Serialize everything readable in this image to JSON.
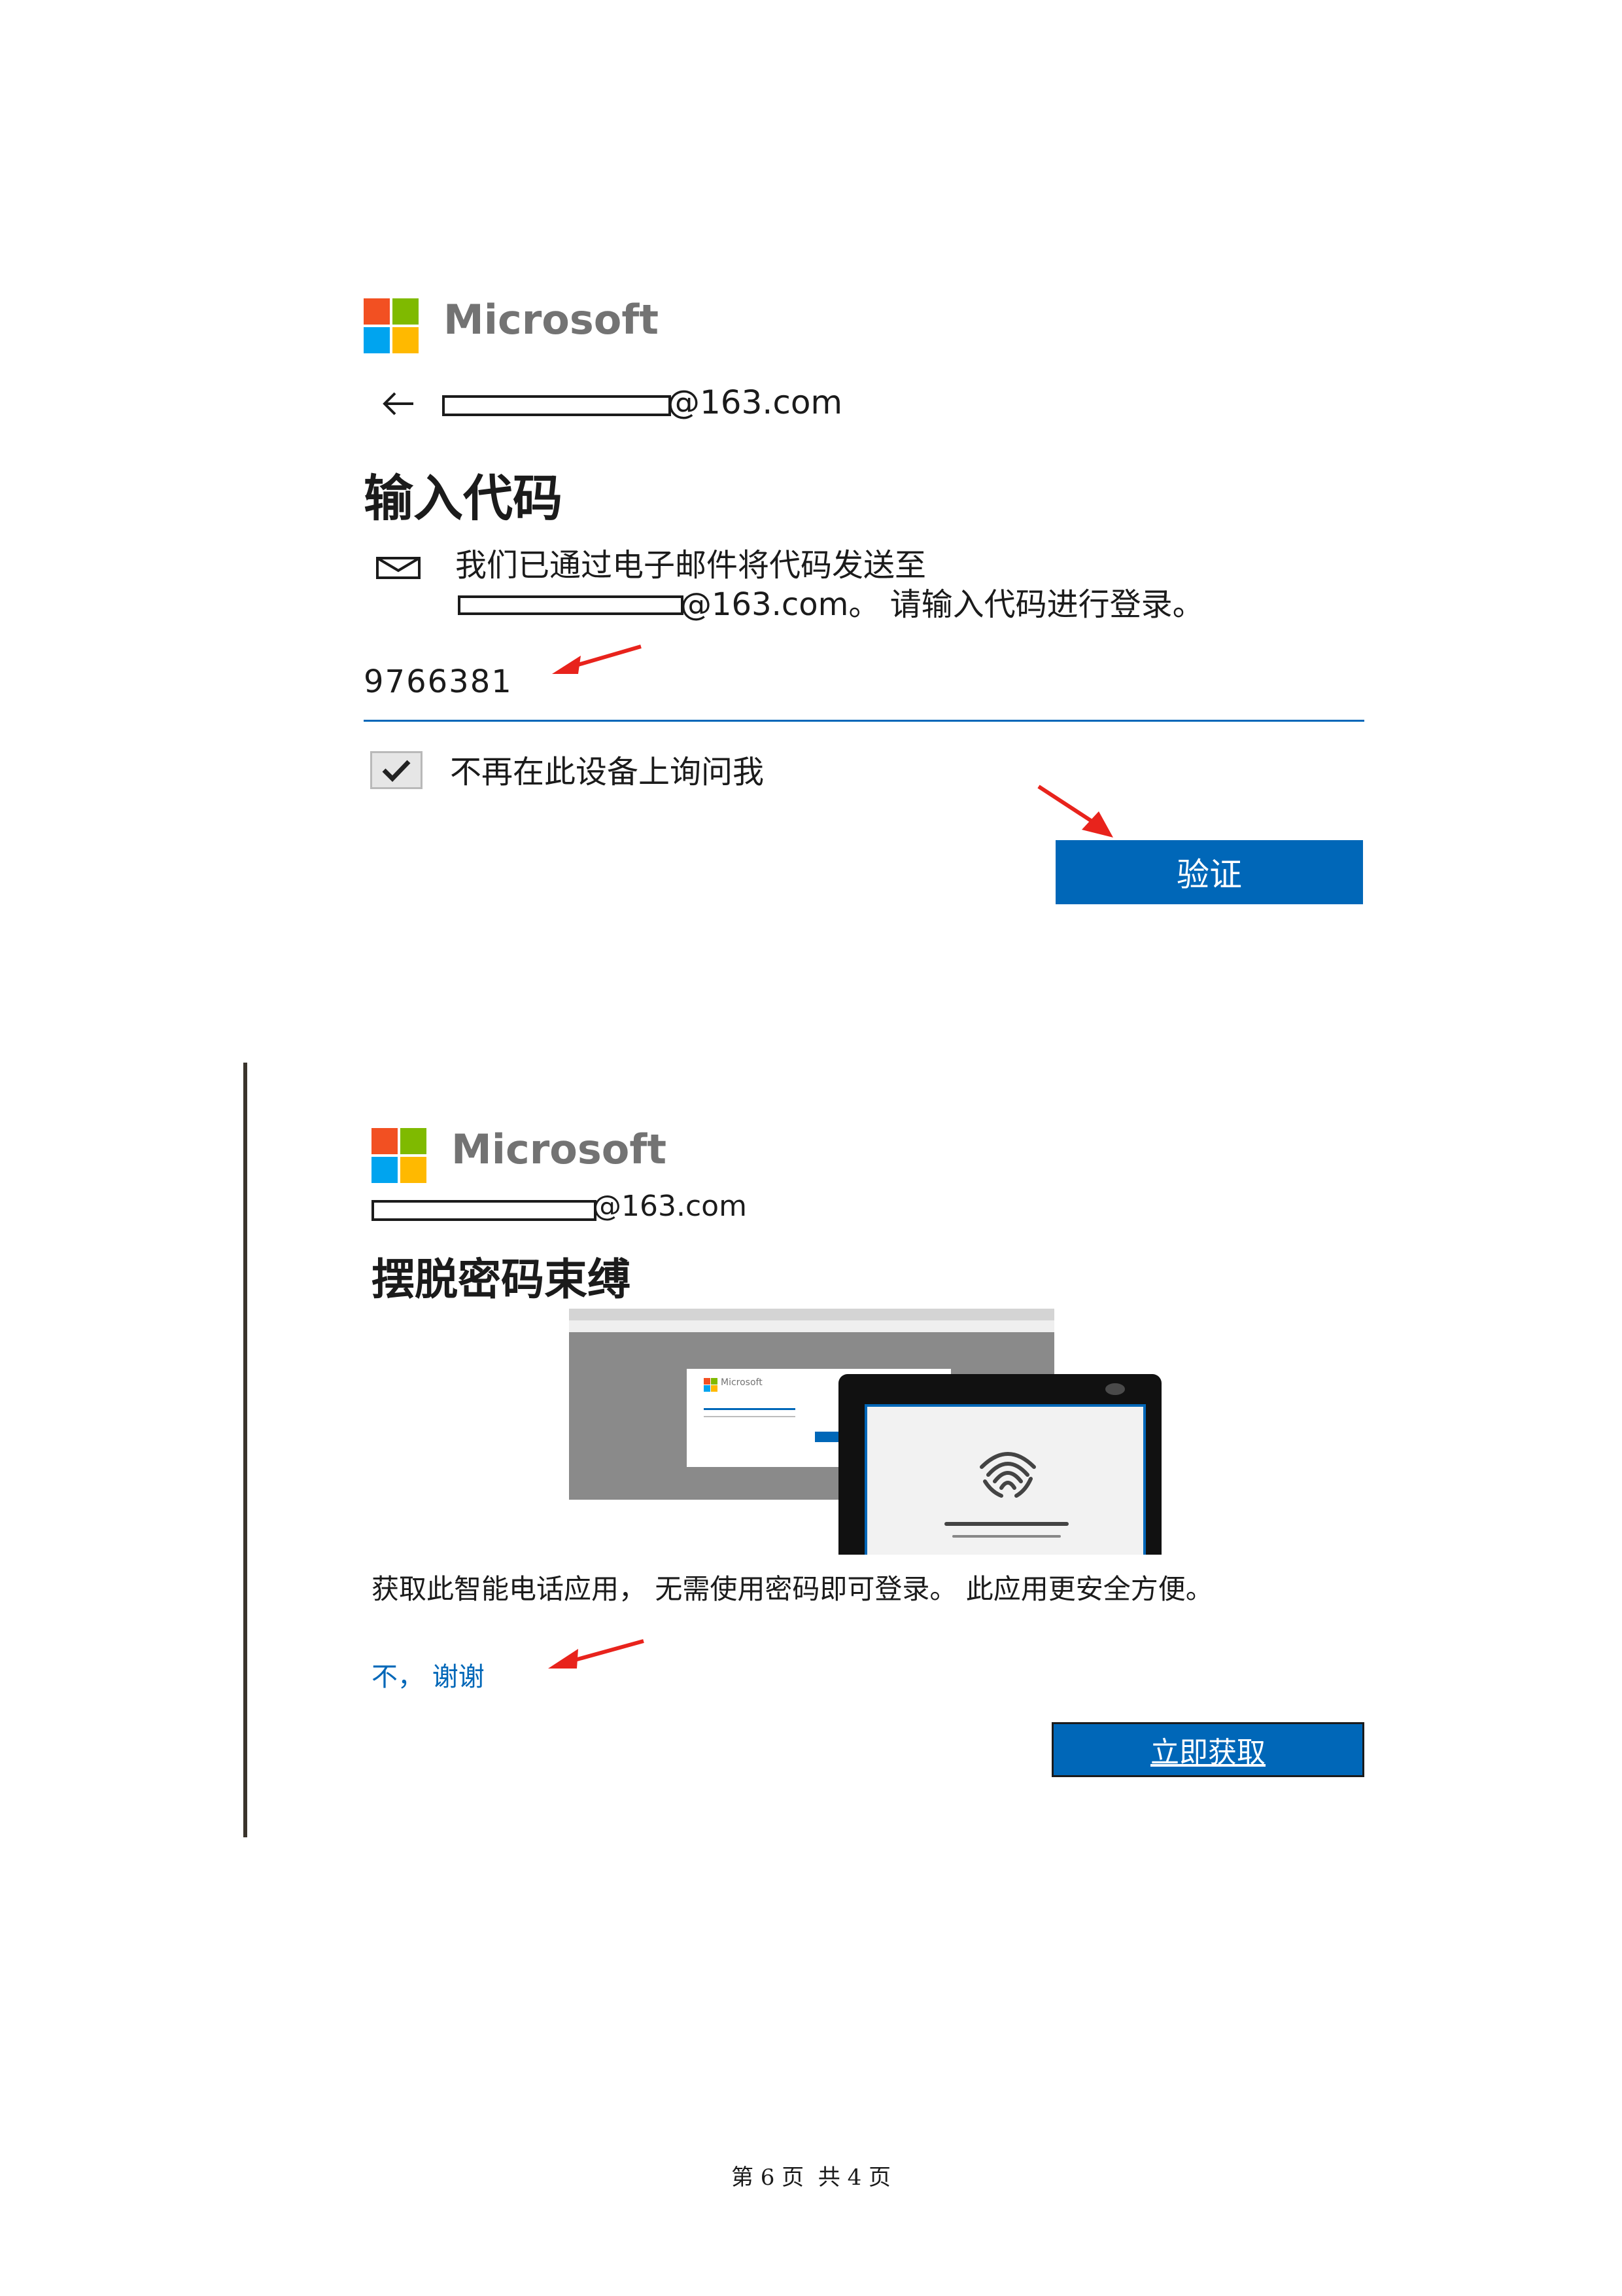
{
  "section1": {
    "brand": "Microsoft",
    "email_suffix": "@163.com",
    "title": "输入代码",
    "message_line1": "我们已通过电子邮件将代码发送至",
    "message_line2": "@163.com。 请输入代码进行登录。",
    "code_value": "9766381",
    "checkbox_label": "不再在此设备上询问我",
    "checkbox_checked": true,
    "verify_button": "验证"
  },
  "section2": {
    "brand": "Microsoft",
    "email_suffix": "@163.com",
    "title": "摆脱密码束缚",
    "illustration_brand": "Microsoft",
    "description": "获取此智能电话应用， 无需使用密码即可登录。 此应用更安全方便。",
    "no_thanks_link": "不， 谢谢",
    "get_now_button": "立即获取"
  },
  "footer": {
    "page_text": "第 6 页  共 4 页"
  },
  "colors": {
    "ms_red": "#f25022",
    "ms_green": "#7fba00",
    "ms_blue": "#00a4ef",
    "ms_yellow": "#ffb900",
    "primary_blue": "#0067b8",
    "arrow_red": "#e8231c"
  }
}
